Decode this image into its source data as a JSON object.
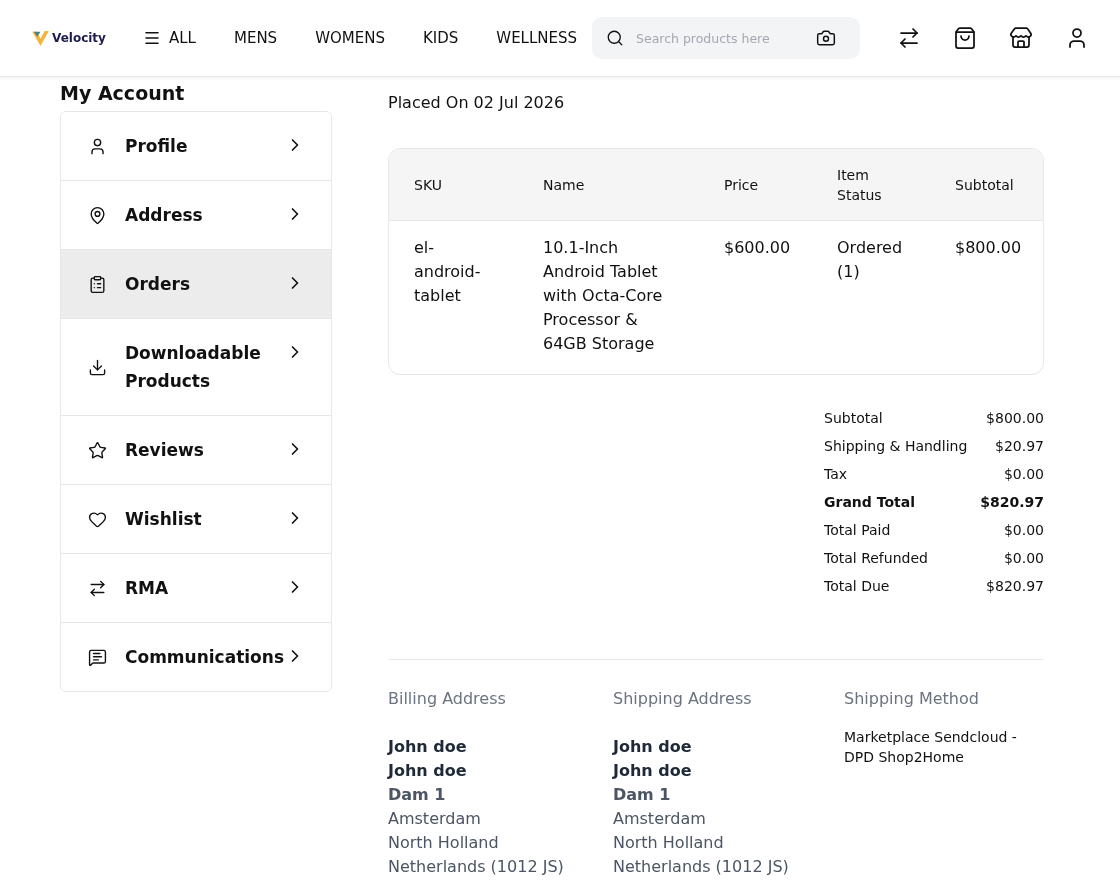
{
  "header": {
    "logo": "Velocity",
    "nav": [
      {
        "label": "ALL",
        "kind": "menu"
      },
      {
        "label": "MENS",
        "kind": "link"
      },
      {
        "label": "WOMENS",
        "kind": "link"
      },
      {
        "label": "KIDS",
        "kind": "link"
      },
      {
        "label": "WELLNESS",
        "kind": "link"
      }
    ],
    "search": {
      "placeholder": "Search products here"
    }
  },
  "sidebar": {
    "title": "My Account",
    "items": [
      {
        "label": "Profile",
        "selected": false
      },
      {
        "label": "Address",
        "selected": false
      },
      {
        "label": "Orders",
        "selected": true
      },
      {
        "label": "Downloadable Products",
        "selected": false
      },
      {
        "label": "Reviews",
        "selected": false
      },
      {
        "label": "Wishlist",
        "selected": false
      },
      {
        "label": "RMA",
        "selected": false
      },
      {
        "label": "Communications",
        "selected": false
      }
    ]
  },
  "order": {
    "placed_on": "Placed On 02 Jul 2026",
    "table": {
      "columns": [
        "SKU",
        "Name",
        "Price",
        "Item Status",
        "Subtotal"
      ],
      "rows": [
        [
          "el-android-tablet",
          "10.1-Inch Android Tablet with Octa-Core Processor & 64GB Storage",
          "$600.00",
          "Ordered (1)",
          "$800.00"
        ]
      ]
    },
    "totals": [
      {
        "label": "Subtotal",
        "value": "$800.00",
        "kind": "line"
      },
      {
        "label": "Shipping & Handling",
        "value": "$20.97",
        "kind": "line"
      },
      {
        "label": "Tax",
        "value": "$0.00",
        "kind": "line"
      },
      {
        "label": "Grand Total",
        "value": "$820.97",
        "kind": "grand"
      },
      {
        "label": "Total Paid",
        "value": "$0.00",
        "kind": "line"
      },
      {
        "label": "Total Refunded",
        "value": "$0.00",
        "kind": "line"
      },
      {
        "label": "Total Due",
        "value": "$820.97",
        "kind": "line"
      }
    ]
  },
  "addresses": [
    {
      "title": "Billing Address",
      "lines": [
        {
          "text": "John doe",
          "kind": "name"
        },
        {
          "text": "John doe",
          "kind": "name"
        },
        {
          "text": "Dam 1",
          "kind": "street"
        },
        {
          "text": "Amsterdam",
          "kind": "line"
        },
        {
          "text": "North Holland",
          "kind": "line"
        },
        {
          "text": "Netherlands (1012 JS)",
          "kind": "line"
        }
      ]
    },
    {
      "title": "Shipping Address",
      "lines": [
        {
          "text": "John doe",
          "kind": "name"
        },
        {
          "text": "John doe",
          "kind": "name"
        },
        {
          "text": "Dam 1",
          "kind": "street"
        },
        {
          "text": "Amsterdam",
          "kind": "line"
        },
        {
          "text": "North Holland",
          "kind": "line"
        },
        {
          "text": "Netherlands (1012 JS)",
          "kind": "line"
        }
      ]
    }
  ],
  "shipping_method": {
    "title": "Shipping Method",
    "text": "Marketplace Sendcloud - DPD Shop2Home"
  }
}
